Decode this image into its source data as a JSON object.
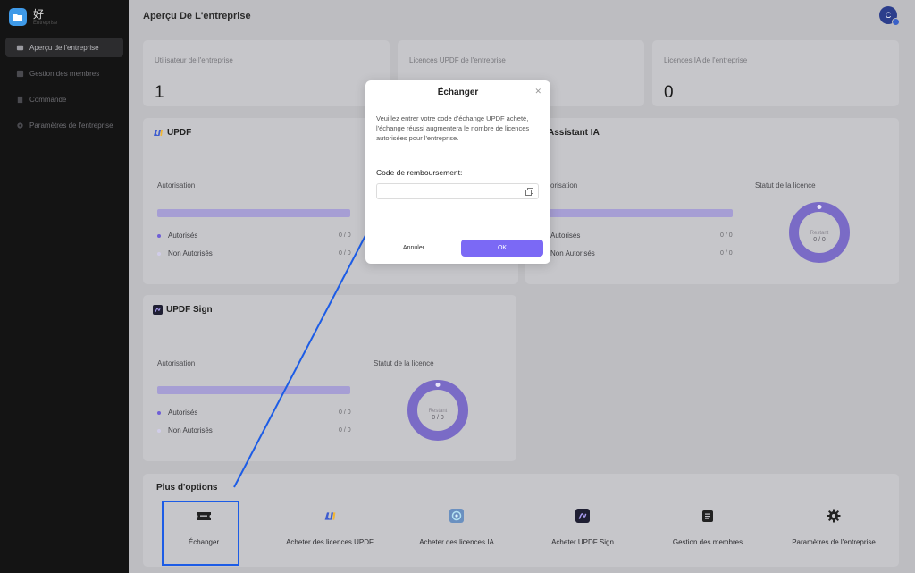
{
  "sidebar": {
    "brand_name": "好",
    "brand_sub": "Entreprise",
    "items": [
      {
        "label": "Aperçu de l'entreprise",
        "icon": "overview-icon",
        "active": true
      },
      {
        "label": "Gestion des membres",
        "icon": "members-icon",
        "active": false
      },
      {
        "label": "Commande",
        "icon": "order-icon",
        "active": false
      },
      {
        "label": "Paramètres de l'entreprise",
        "icon": "gear-icon",
        "active": false
      }
    ]
  },
  "header": {
    "title": "Aperçu De L'entreprise",
    "avatar_initial": "C"
  },
  "stats": [
    {
      "label": "Utilisateur de l'entreprise",
      "value": "1"
    },
    {
      "label": "Licences UPDF de l'entreprise",
      "value": "0"
    },
    {
      "label": "Licences IA de l'entreprise",
      "value": "0"
    }
  ],
  "updf": {
    "title": "UPDF",
    "auth_label": "Autorisation",
    "authorized_label": "Autorisés",
    "authorized_count": "0 / 0",
    "unauthorized_label": "Non Autorisés",
    "unauthorized_count": "0 / 0"
  },
  "ia": {
    "title": "Assistant IA",
    "auth_label": "Autorisation",
    "authorized_label": "Autorisés",
    "authorized_count": "0 / 0",
    "unauthorized_label": "Non Autorisés",
    "unauthorized_count": "0 / 0",
    "status_label": "Statut de la licence",
    "remaining_label": "Restant",
    "remaining_value": "0 / 0"
  },
  "sign": {
    "title": "UPDF Sign",
    "auth_label": "Autorisation",
    "authorized_label": "Autorisés",
    "authorized_count": "0 / 0",
    "unauthorized_label": "Non Autorisés",
    "unauthorized_count": "0 / 0",
    "status_label": "Statut de la licence",
    "remaining_label": "Restant",
    "remaining_value": "0 / 0"
  },
  "options": {
    "title": "Plus d'options",
    "items": [
      {
        "label": "Échanger",
        "icon": "ticket-icon"
      },
      {
        "label": "Acheter des licences UPDF",
        "icon": "updf-logo-icon"
      },
      {
        "label": "Acheter des licences IA",
        "icon": "ai-icon"
      },
      {
        "label": "Acheter UPDF Sign",
        "icon": "sign-icon"
      },
      {
        "label": "Gestion des membres",
        "icon": "document-icon"
      },
      {
        "label": "Paramètres de l'entreprise",
        "icon": "gear-icon"
      }
    ]
  },
  "modal": {
    "title": "Échanger",
    "description": "Veuillez entrer votre code d'échange UPDF acheté, l'échange réussi augmentera le nombre de licences autorisées pour l'entreprise.",
    "field_label": "Code de remboursement:",
    "field_value": "",
    "cancel_label": "Annuler",
    "ok_label": "OK"
  },
  "colors": {
    "accent": "#7b69f5",
    "highlight": "#1c5ce6",
    "sidebar_bg": "#141414",
    "logo": "#3f9ae8"
  }
}
